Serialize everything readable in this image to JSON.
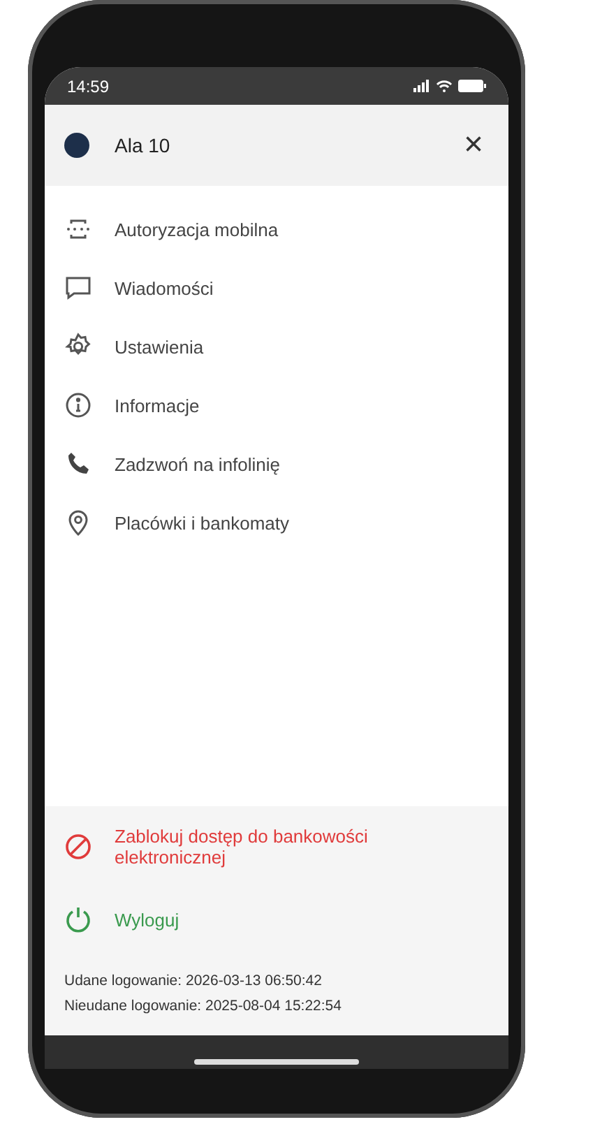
{
  "status_bar": {
    "time": "14:59"
  },
  "header": {
    "user_name": "Ala 10",
    "close": "×"
  },
  "menu": [
    {
      "kind": "auth",
      "label": "Autoryzacja mobilna"
    },
    {
      "kind": "message",
      "label": "Wiadomości"
    },
    {
      "kind": "settings",
      "label": "Ustawienia"
    },
    {
      "kind": "info",
      "label": "Informacje"
    },
    {
      "kind": "phone",
      "label": "Zadzwoń na infolinię"
    },
    {
      "kind": "location",
      "label": "Placówki i bankomaty"
    }
  ],
  "actions": [
    {
      "kind": "block",
      "label": "Zablokuj dostęp do bankowości elektronicznej"
    },
    {
      "kind": "logout",
      "label": "Wyloguj"
    }
  ],
  "login_info": [
    "Udane logowanie: 2026-03-13 06:50:42",
    "Nieudane logowanie: 2025-08-04 15:22:54"
  ]
}
